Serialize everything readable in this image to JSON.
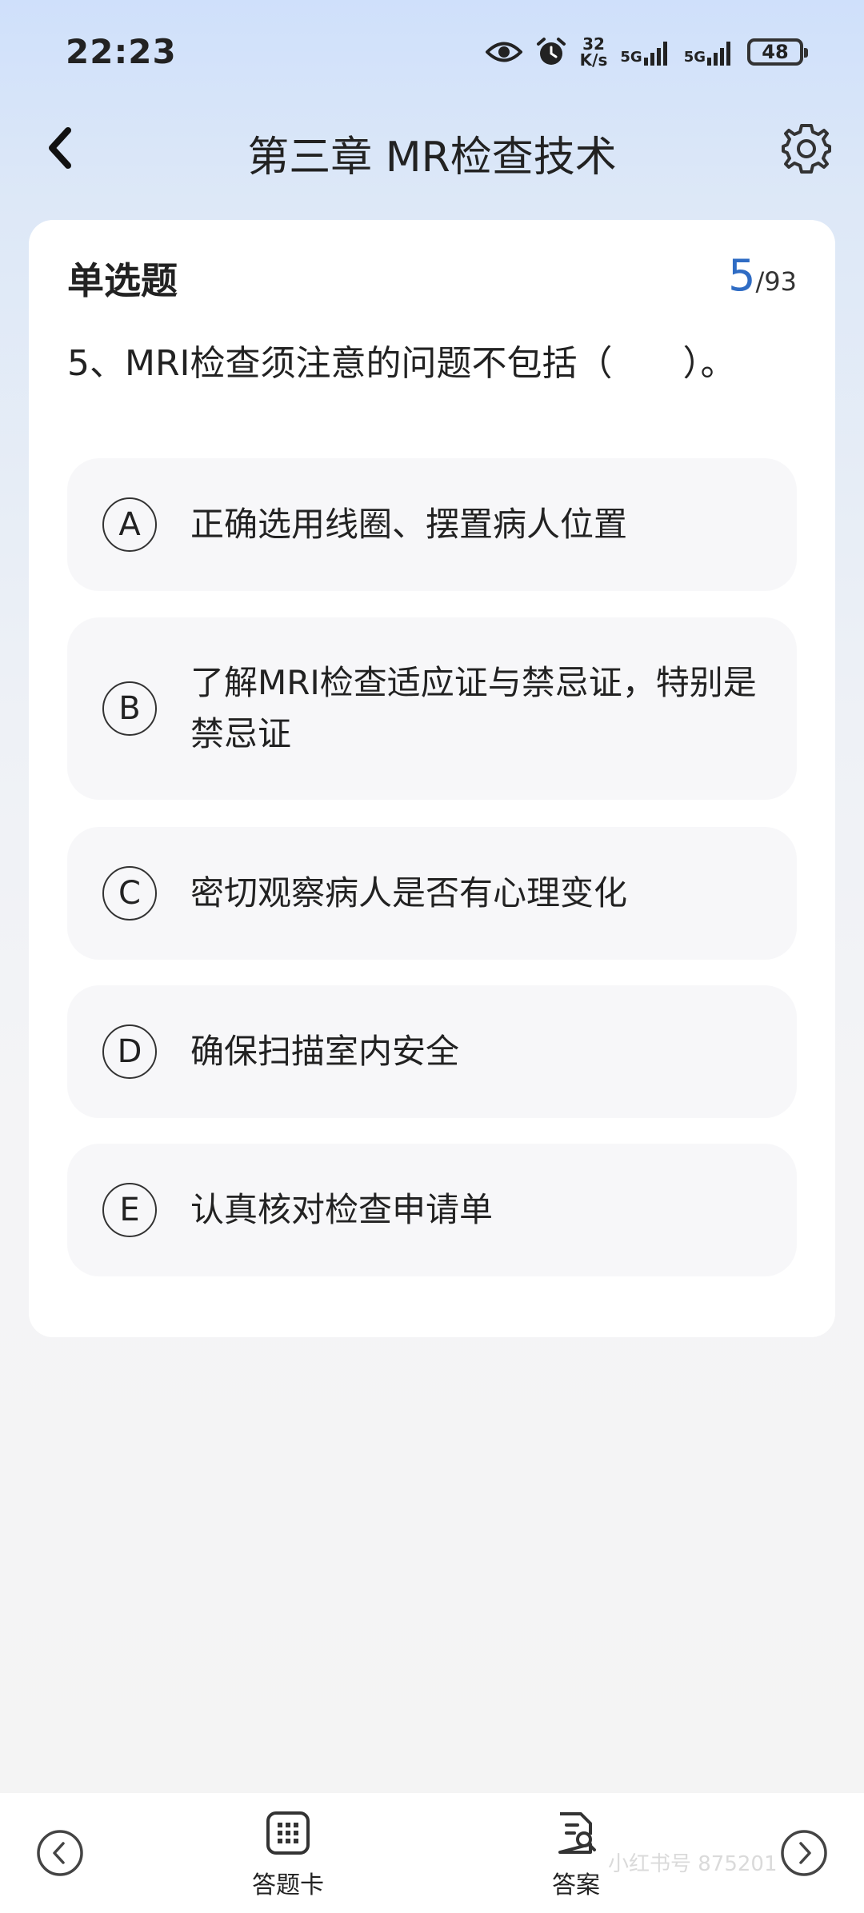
{
  "status_bar": {
    "time": "22:23",
    "net_speed_value": "32",
    "net_speed_unit": "K/s",
    "signal1_label": "5G",
    "signal2_label": "5G",
    "battery": "48"
  },
  "nav": {
    "title": "第三章 MR检查技术"
  },
  "question": {
    "type": "单选题",
    "current": "5",
    "total": "/93",
    "text": "5、MRI检查须注意的问题不包括（　　）。",
    "options": [
      {
        "letter": "A",
        "text": "正确选用线圈、摆置病人位置"
      },
      {
        "letter": "B",
        "text": "了解MRI检查适应证与禁忌证，特别是禁忌证"
      },
      {
        "letter": "C",
        "text": "密切观察病人是否有心理变化"
      },
      {
        "letter": "D",
        "text": "确保扫描室内安全"
      },
      {
        "letter": "E",
        "text": "认真核对检查申请单"
      }
    ]
  },
  "bottom_bar": {
    "answer_card_label": "答题卡",
    "answer_label": "答案"
  },
  "watermark": "小红书号 875201"
}
